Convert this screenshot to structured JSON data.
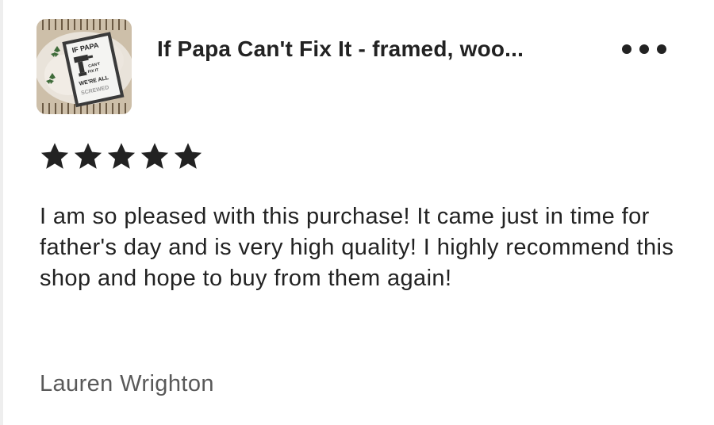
{
  "listing": {
    "title": "If Papa Can't Fix It - framed, woo...",
    "thumbnail_alt": "Framed sign: If Papa can't fix it we're all screwed",
    "thumbnail_text": {
      "line1": "IF PAPA",
      "line2": "CAN'T",
      "line3": "FIX IT",
      "line4": "WE'RE ALL",
      "line5": "SCREWED"
    },
    "more_icon": "ellipsis-icon"
  },
  "review": {
    "rating": 5,
    "max_rating": 5,
    "star_color": "#222222",
    "text": "I am so pleased with this purchase! It came just in time for father's day and is very high quality! I highly recommend this shop and hope to buy from them again!",
    "author": "Lauren Wrighton"
  },
  "colors": {
    "text": "#222222",
    "muted": "#595959",
    "background": "#ffffff"
  }
}
